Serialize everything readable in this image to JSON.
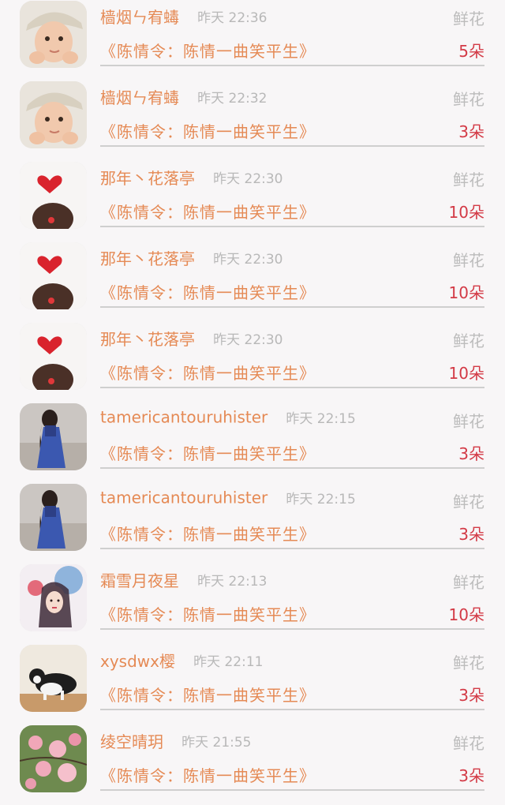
{
  "gift_list": [
    {
      "avatar": "boy-in-cap-photo",
      "name": "樯烟ㄣ宥蝳",
      "time": "昨天 22:36",
      "label": "鲜花",
      "work": "《陈情令：陈情一曲笑平生》",
      "count": "5朵"
    },
    {
      "avatar": "boy-in-cap-photo",
      "name": "樯烟ㄣ宥蝳",
      "time": "昨天 22:32",
      "label": "鲜花",
      "work": "《陈情令：陈情一曲笑平生》",
      "count": "3朵"
    },
    {
      "avatar": "heart-and-hair-photo",
      "name": "那年丶花落亭",
      "time": "昨天 22:30",
      "label": "鲜花",
      "work": "《陈情令：陈情一曲笑平生》",
      "count": "10朵"
    },
    {
      "avatar": "heart-and-hair-photo",
      "name": "那年丶花落亭",
      "time": "昨天 22:30",
      "label": "鲜花",
      "work": "《陈情令：陈情一曲笑平生》",
      "count": "10朵"
    },
    {
      "avatar": "heart-and-hair-photo",
      "name": "那年丶花落亭",
      "time": "昨天 22:30",
      "label": "鲜花",
      "work": "《陈情令：陈情一曲笑平生》",
      "count": "10朵"
    },
    {
      "avatar": "girl-in-blue-dress-photo",
      "name": "tamericantouruhister",
      "time": "昨天 22:15",
      "label": "鲜花",
      "work": "《陈情令：陈情一曲笑平生》",
      "count": "3朵"
    },
    {
      "avatar": "girl-in-blue-dress-photo",
      "name": "tamericantouruhister",
      "time": "昨天 22:15",
      "label": "鲜花",
      "work": "《陈情令：陈情一曲笑平生》",
      "count": "3朵"
    },
    {
      "avatar": "anime-girl-illustration",
      "name": "霜雪月夜星",
      "time": "昨天 22:13",
      "label": "鲜花",
      "work": "《陈情令：陈情一曲笑平生》",
      "count": "10朵"
    },
    {
      "avatar": "black-white-cat-photo",
      "name": "xysdwx樱",
      "time": "昨天 22:11",
      "label": "鲜花",
      "work": "《陈情令：陈情一曲笑平生》",
      "count": "3朵"
    },
    {
      "avatar": "pink-blossoms-photo",
      "name": "绫空晴玥",
      "time": "昨天 21:55",
      "label": "鲜花",
      "work": "《陈情令：陈情一曲笑平生》",
      "count": "3朵"
    }
  ]
}
